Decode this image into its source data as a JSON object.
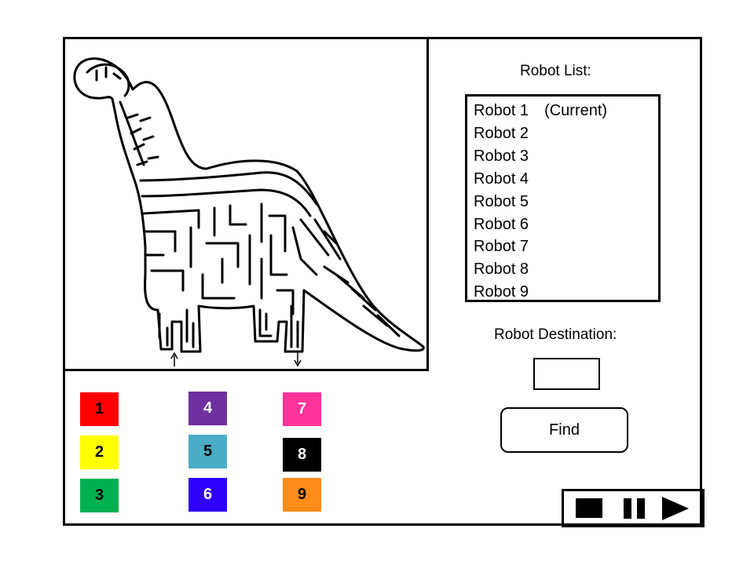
{
  "robot_list": {
    "title": "Robot List:",
    "items": [
      {
        "label": "Robot 1",
        "tag": "(Current)"
      },
      {
        "label": "Robot 2",
        "tag": ""
      },
      {
        "label": "Robot 3",
        "tag": ""
      },
      {
        "label": "Robot 4",
        "tag": ""
      },
      {
        "label": "Robot 5",
        "tag": ""
      },
      {
        "label": "Robot 6",
        "tag": ""
      },
      {
        "label": "Robot 7",
        "tag": ""
      },
      {
        "label": "Robot 8",
        "tag": ""
      },
      {
        "label": "Robot 9",
        "tag": ""
      }
    ]
  },
  "destination": {
    "label": "Robot Destination:",
    "value": ""
  },
  "find_button": {
    "label": "Find"
  },
  "swatches": [
    {
      "label": "1",
      "color": "#ff0000",
      "text_color": "#000000"
    },
    {
      "label": "2",
      "color": "#ffff00",
      "text_color": "#000000"
    },
    {
      "label": "3",
      "color": "#00b050",
      "text_color": "#000000"
    },
    {
      "label": "4",
      "color": "#7030a0",
      "text_color": "#ffffff"
    },
    {
      "label": "5",
      "color": "#4bacc6",
      "text_color": "#000000"
    },
    {
      "label": "6",
      "color": "#2f00ff",
      "text_color": "#ffffff"
    },
    {
      "label": "7",
      "color": "#ff3399",
      "text_color": "#ffffff"
    },
    {
      "label": "8",
      "color": "#000000",
      "text_color": "#ffffff"
    },
    {
      "label": "9",
      "color": "#ff8c1a",
      "text_color": "#000000"
    }
  ],
  "controls": [
    {
      "icon": "stop-icon"
    },
    {
      "icon": "pause-icon"
    },
    {
      "icon": "play-icon"
    }
  ],
  "maze": {
    "image": "dinosaur-maze"
  }
}
